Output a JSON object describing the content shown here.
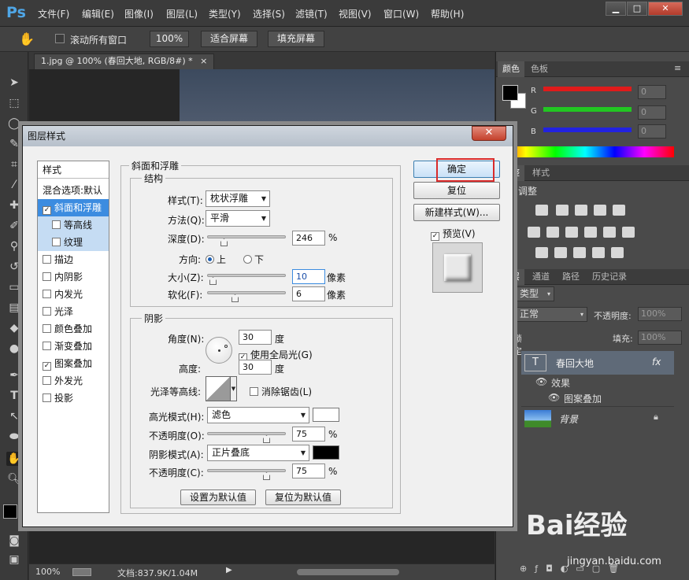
{
  "app": {
    "logo": "Ps"
  },
  "menu": [
    "文件(F)",
    "编辑(E)",
    "图像(I)",
    "图层(L)",
    "类型(Y)",
    "选择(S)",
    "滤镜(T)",
    "视图(V)",
    "窗口(W)",
    "帮助(H)"
  ],
  "window_controls": {
    "minimize": "▁",
    "maximize": "□",
    "close": "✕"
  },
  "options_bar": {
    "scroll_all_label": "滚动所有窗口",
    "zoom_100": "100%",
    "fit_screen": "适合屏幕",
    "fill_screen": "填充屏幕"
  },
  "document": {
    "tab_title": "1.jpg @ 100% (春回大地, RGB/8#) *",
    "tab_close": "×"
  },
  "status": {
    "zoom": "100%",
    "doc_info": "文档:837.9K/1.04M"
  },
  "color_panel": {
    "tabs": [
      "颜色",
      "色板"
    ],
    "channels": [
      {
        "label": "R",
        "value": "0",
        "color": "#e01b1b"
      },
      {
        "label": "G",
        "value": "0",
        "color": "#22c622"
      },
      {
        "label": "B",
        "value": "0",
        "color": "#2222e0"
      }
    ]
  },
  "adjust_panel": {
    "tabs": [
      "调整",
      "样式"
    ],
    "title": "添加调整"
  },
  "layers_panel": {
    "tabs": [
      "图层",
      "通道",
      "路径",
      "历史记录"
    ],
    "filter_kind": "类型",
    "blend_mode": "正常",
    "opacity_label": "不透明度:",
    "opacity_value": "100%",
    "lock_label": "锁定:",
    "fill_label": "填充:",
    "fill_value": "100%",
    "layers": [
      {
        "name": "春回大地",
        "type": "text",
        "fx": "fx"
      },
      {
        "name": "效果",
        "type": "effect"
      },
      {
        "name": "图案叠加",
        "type": "effect-item"
      },
      {
        "name": "背景",
        "type": "image"
      }
    ]
  },
  "dialog": {
    "title": "图层样式",
    "close": "✕",
    "style_list": [
      {
        "label": "样式",
        "checkbox": false,
        "checked": false,
        "state": "header"
      },
      {
        "label": "混合选项:默认",
        "checkbox": false,
        "checked": false,
        "state": "normal"
      },
      {
        "label": "斜面和浮雕",
        "checkbox": true,
        "checked": true,
        "state": "selected"
      },
      {
        "label": "等高线",
        "checkbox": true,
        "checked": false,
        "state": "sub"
      },
      {
        "label": "纹理",
        "checkbox": true,
        "checked": false,
        "state": "sub"
      },
      {
        "label": "描边",
        "checkbox": true,
        "checked": false,
        "state": "normal"
      },
      {
        "label": "内阴影",
        "checkbox": true,
        "checked": false,
        "state": "normal"
      },
      {
        "label": "内发光",
        "checkbox": true,
        "checked": false,
        "state": "normal"
      },
      {
        "label": "光泽",
        "checkbox": true,
        "checked": false,
        "state": "normal"
      },
      {
        "label": "颜色叠加",
        "checkbox": true,
        "checked": false,
        "state": "normal"
      },
      {
        "label": "渐变叠加",
        "checkbox": true,
        "checked": false,
        "state": "normal"
      },
      {
        "label": "图案叠加",
        "checkbox": true,
        "checked": true,
        "state": "normal"
      },
      {
        "label": "外发光",
        "checkbox": true,
        "checked": false,
        "state": "normal"
      },
      {
        "label": "投影",
        "checkbox": true,
        "checked": false,
        "state": "normal"
      }
    ],
    "bevel": {
      "section_title": "斜面和浮雕",
      "structure_title": "结构",
      "style_label": "样式(T):",
      "style_value": "枕状浮雕",
      "technique_label": "方法(Q):",
      "technique_value": "平滑",
      "depth_label": "深度(D):",
      "depth_value": "246",
      "depth_unit": "%",
      "depth_level": 0.2,
      "direction_label": "方向:",
      "direction_up": "上",
      "direction_down": "下",
      "size_label": "大小(Z):",
      "size_value": "10",
      "size_unit": "像素",
      "size_level": 0.05,
      "soften_label": "软化(F):",
      "soften_value": "6",
      "soften_unit": "像素",
      "soften_level": 0.35
    },
    "shading": {
      "title": "阴影",
      "angle_label": "角度(N):",
      "angle_value": "30",
      "angle_unit": "度",
      "global_light_label": "使用全局光(G)",
      "altitude_label": "高度:",
      "altitude_value": "30",
      "altitude_unit": "度",
      "gloss_contour_label": "光泽等高线:",
      "anti_alias_label": "消除锯齿(L)",
      "highlight_mode_label": "高光模式(H):",
      "highlight_mode_value": "滤色",
      "highlight_color": "#ffffff",
      "highlight_opacity_label": "不透明度(O):",
      "highlight_opacity_value": "75",
      "highlight_opacity_unit": "%",
      "highlight_opacity_level": 0.75,
      "shadow_mode_label": "阴影模式(A):",
      "shadow_mode_value": "正片叠底",
      "shadow_color": "#000000",
      "shadow_opacity_label": "不透明度(C):",
      "shadow_opacity_value": "75",
      "shadow_opacity_unit": "%",
      "shadow_opacity_level": 0.75
    },
    "default_buttons": {
      "make_default": "设置为默认值",
      "reset_default": "复位为默认值"
    },
    "actions": {
      "ok": "确定",
      "reset": "复位",
      "new_style": "新建样式(W)...",
      "preview": "预览(V)"
    }
  },
  "watermark": {
    "brand": "Bai经验",
    "url": "jingyan.baidu.com"
  }
}
